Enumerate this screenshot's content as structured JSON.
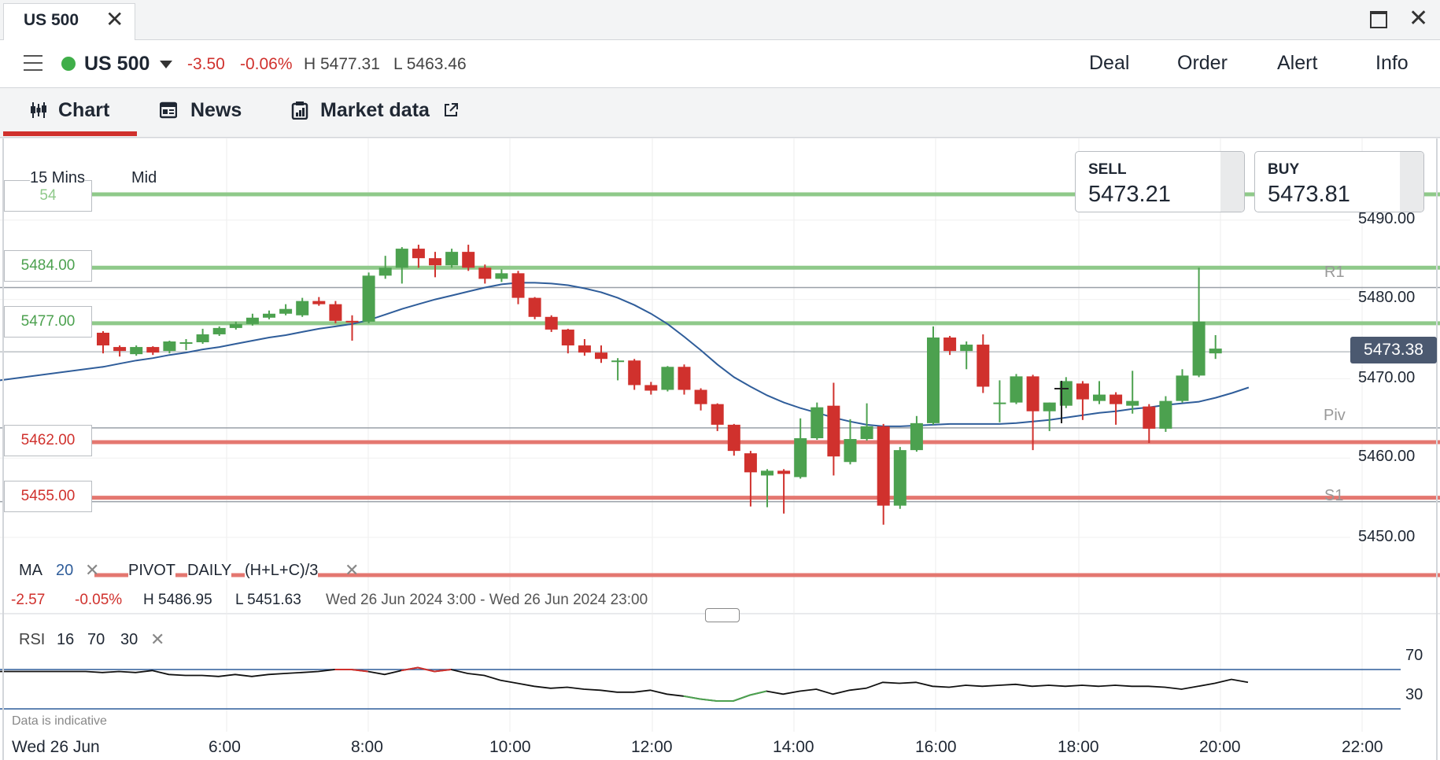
{
  "window": {
    "tab_title": "US 500",
    "tab_close": "✕",
    "maximize_icon": "window-maximize-icon",
    "close_icon": "✕"
  },
  "instrument": {
    "name": "US 500",
    "status_color": "#3fae49",
    "change": "-3.50",
    "change_pct": "-0.06%",
    "high": "H 5477.31",
    "low": "L 5463.46"
  },
  "actions": {
    "deal": "Deal",
    "order": "Order",
    "alert": "Alert",
    "info": "Info"
  },
  "view_tabs": {
    "chart": "Chart",
    "news": "News",
    "market_data": "Market data"
  },
  "chart_controls": {
    "timeframe": "15 Mins",
    "price_type": "Mid"
  },
  "quotes": {
    "sell_label": "SELL",
    "sell_value": "5473.21",
    "buy_label": "BUY",
    "buy_value": "5473.81"
  },
  "level_labels": {
    "top_partial": "54",
    "r_green_1": "5484.00",
    "r_green_2": "5477.00",
    "s_red_1": "5462.00",
    "s_red_2": "5455.00"
  },
  "pivot_labels": {
    "r1": "R1",
    "piv": "Piv",
    "s1": "S1"
  },
  "current_price": "5473.38",
  "indicators": {
    "ma_label": "MA",
    "ma_period": "20",
    "pivot_label": "PIVOT",
    "pivot_period": "DAILY",
    "pivot_formula": "(H+L+C)/3",
    "close": "✕"
  },
  "summary": {
    "change": "-2.57",
    "change_pct": "-0.05%",
    "high": "H 5486.95",
    "low": "L 5451.63",
    "range": "Wed 26 Jun 2024 3:00 - Wed 26 Jun 2024 23:00"
  },
  "rsi": {
    "label": "RSI",
    "period": "16",
    "upper": "70",
    "lower": "30",
    "tick_upper": "70",
    "tick_lower": "30",
    "values": [
      68,
      67,
      68,
      67,
      69,
      65,
      64,
      64,
      63,
      65,
      63,
      65,
      66,
      67,
      68,
      70,
      70,
      68,
      65,
      69,
      72,
      68,
      70,
      66,
      64,
      59,
      56,
      53,
      51,
      52,
      50,
      49,
      47,
      47,
      49,
      45,
      43,
      40,
      38,
      38,
      44,
      48,
      45,
      48,
      50,
      45,
      49,
      51,
      57,
      56,
      57,
      53,
      52,
      54,
      53,
      54,
      55,
      53,
      54,
      53,
      54,
      53,
      54,
      53,
      53,
      52,
      50,
      53,
      56,
      60,
      57
    ]
  },
  "disclaimer": "Data is indicative",
  "x_axis": {
    "date_label": "Wed 26 Jun",
    "ticks": [
      "6:00",
      "8:00",
      "10:00",
      "12:00",
      "14:00",
      "16:00",
      "18:00",
      "20:00",
      "22:00"
    ]
  },
  "colors": {
    "up": "#4ca14f",
    "down": "#d0312d",
    "ma": "#2f5d9a",
    "resistance": "#8fc98a",
    "support": "#e47770",
    "grid": "#9aa0a8"
  },
  "chart_data": {
    "type": "candlestick",
    "timeframe": "15 Mins",
    "y_ticks": [
      "5450.00",
      "5460.00",
      "5470.00",
      "5480.00",
      "5490.00"
    ],
    "ylim": [
      5444,
      5498
    ],
    "horizontal_levels": {
      "R1": 5481.5,
      "Pivot": 5463.8,
      "S1": 5454.5,
      "resistance": [
        5484.0,
        5477.0
      ],
      "support": [
        5462.0,
        5455.0
      ]
    },
    "moving_average": {
      "period": 20,
      "values": [
        5471.5,
        5471.9,
        5472.3,
        5472.6,
        5473.0,
        5473.3,
        5473.7,
        5474.0,
        5474.4,
        5474.8,
        5475.2,
        5475.5,
        5475.9,
        5476.3,
        5476.6,
        5476.9,
        5477.4,
        5478.1,
        5478.8,
        5479.4,
        5480.0,
        5480.5,
        5481.0,
        5481.5,
        5481.9,
        5482.1,
        5482.1,
        5482.0,
        5481.8,
        5481.4,
        5480.9,
        5480.2,
        5479.3,
        5478.2,
        5476.9,
        5475.3,
        5473.6,
        5471.8,
        5470.2,
        5469.0,
        5467.9,
        5467.0,
        5466.3,
        5465.7,
        5465.1,
        5464.6,
        5464.2,
        5464.0,
        5464.0,
        5464.1,
        5464.2,
        5464.3,
        5464.3,
        5464.3,
        5464.3,
        5464.4,
        5464.6,
        5464.8,
        5465.1,
        5465.4,
        5465.7,
        5465.9,
        5466.2,
        5466.4,
        5466.7,
        5466.9,
        5467.1,
        5467.6,
        5468.2,
        5468.9
      ]
    },
    "candles": [
      {
        "o": 5475.8,
        "h": 5476.0,
        "l": 5473.2,
        "c": 5474.2
      },
      {
        "o": 5474.0,
        "h": 5474.2,
        "l": 5472.8,
        "c": 5473.5
      },
      {
        "o": 5473.1,
        "h": 5474.2,
        "l": 5472.9,
        "c": 5474.0
      },
      {
        "o": 5474.0,
        "h": 5474.1,
        "l": 5473.0,
        "c": 5473.3
      },
      {
        "o": 5473.5,
        "h": 5474.8,
        "l": 5473.2,
        "c": 5474.7
      },
      {
        "o": 5474.5,
        "h": 5475.0,
        "l": 5473.6,
        "c": 5474.6
      },
      {
        "o": 5474.6,
        "h": 5476.3,
        "l": 5474.4,
        "c": 5475.6
      },
      {
        "o": 5475.6,
        "h": 5476.6,
        "l": 5475.4,
        "c": 5476.4
      },
      {
        "o": 5476.4,
        "h": 5477.2,
        "l": 5476.2,
        "c": 5476.9
      },
      {
        "o": 5476.9,
        "h": 5478.2,
        "l": 5476.7,
        "c": 5477.7
      },
      {
        "o": 5477.7,
        "h": 5478.6,
        "l": 5477.5,
        "c": 5478.2
      },
      {
        "o": 5478.2,
        "h": 5479.4,
        "l": 5478.0,
        "c": 5478.8
      },
      {
        "o": 5478.0,
        "h": 5480.2,
        "l": 5477.8,
        "c": 5479.8
      },
      {
        "o": 5479.8,
        "h": 5480.3,
        "l": 5479.2,
        "c": 5479.4
      },
      {
        "o": 5479.4,
        "h": 5479.8,
        "l": 5477.0,
        "c": 5477.3
      },
      {
        "o": 5477.3,
        "h": 5478.0,
        "l": 5474.8,
        "c": 5477.2
      },
      {
        "o": 5477.2,
        "h": 5483.4,
        "l": 5477.0,
        "c": 5483.0
      },
      {
        "o": 5483.0,
        "h": 5485.5,
        "l": 5482.6,
        "c": 5484.0
      },
      {
        "o": 5484.0,
        "h": 5486.6,
        "l": 5482.0,
        "c": 5486.4
      },
      {
        "o": 5486.4,
        "h": 5486.9,
        "l": 5484.0,
        "c": 5485.2
      },
      {
        "o": 5485.2,
        "h": 5486.0,
        "l": 5482.8,
        "c": 5484.3
      },
      {
        "o": 5484.3,
        "h": 5486.4,
        "l": 5484.0,
        "c": 5486.0
      },
      {
        "o": 5486.0,
        "h": 5486.9,
        "l": 5483.6,
        "c": 5484.0
      },
      {
        "o": 5484.0,
        "h": 5484.4,
        "l": 5482.0,
        "c": 5482.6
      },
      {
        "o": 5482.6,
        "h": 5483.8,
        "l": 5482.2,
        "c": 5483.3
      },
      {
        "o": 5483.3,
        "h": 5483.6,
        "l": 5479.4,
        "c": 5480.2
      },
      {
        "o": 5480.2,
        "h": 5480.3,
        "l": 5477.5,
        "c": 5477.8
      },
      {
        "o": 5477.8,
        "h": 5478.0,
        "l": 5475.9,
        "c": 5476.2
      },
      {
        "o": 5476.2,
        "h": 5476.3,
        "l": 5473.2,
        "c": 5474.2
      },
      {
        "o": 5474.2,
        "h": 5475.0,
        "l": 5472.9,
        "c": 5473.3
      },
      {
        "o": 5473.3,
        "h": 5474.2,
        "l": 5472.0,
        "c": 5472.5
      },
      {
        "o": 5472.3,
        "h": 5472.6,
        "l": 5469.8,
        "c": 5472.3
      },
      {
        "o": 5472.3,
        "h": 5472.5,
        "l": 5468.6,
        "c": 5469.2
      },
      {
        "o": 5469.2,
        "h": 5469.6,
        "l": 5468.0,
        "c": 5468.5
      },
      {
        "o": 5468.6,
        "h": 5471.6,
        "l": 5468.4,
        "c": 5471.5
      },
      {
        "o": 5471.5,
        "h": 5471.8,
        "l": 5468.0,
        "c": 5468.6
      },
      {
        "o": 5468.6,
        "h": 5468.8,
        "l": 5466.0,
        "c": 5466.8
      },
      {
        "o": 5466.8,
        "h": 5466.9,
        "l": 5463.4,
        "c": 5464.2
      },
      {
        "o": 5464.2,
        "h": 5464.3,
        "l": 5460.3,
        "c": 5460.9
      },
      {
        "o": 5460.6,
        "h": 5460.9,
        "l": 5453.9,
        "c": 5458.2
      },
      {
        "o": 5457.8,
        "h": 5458.6,
        "l": 5453.8,
        "c": 5458.4
      },
      {
        "o": 5458.4,
        "h": 5458.6,
        "l": 5453.0,
        "c": 5458.0
      },
      {
        "o": 5457.6,
        "h": 5465.0,
        "l": 5457.4,
        "c": 5462.5
      },
      {
        "o": 5462.5,
        "h": 5467.0,
        "l": 5462.3,
        "c": 5466.4
      },
      {
        "o": 5466.6,
        "h": 5469.5,
        "l": 5457.8,
        "c": 5460.2
      },
      {
        "o": 5459.5,
        "h": 5464.9,
        "l": 5459.2,
        "c": 5462.4
      },
      {
        "o": 5462.4,
        "h": 5466.9,
        "l": 5462.2,
        "c": 5464.0
      },
      {
        "o": 5464.0,
        "h": 5464.3,
        "l": 5451.6,
        "c": 5454.0
      },
      {
        "o": 5454.0,
        "h": 5461.4,
        "l": 5453.6,
        "c": 5461.0
      },
      {
        "o": 5461.0,
        "h": 5465.3,
        "l": 5460.8,
        "c": 5464.4
      },
      {
        "o": 5464.4,
        "h": 5476.6,
        "l": 5464.2,
        "c": 5475.2
      },
      {
        "o": 5475.2,
        "h": 5475.4,
        "l": 5473.0,
        "c": 5473.5
      },
      {
        "o": 5473.5,
        "h": 5474.7,
        "l": 5471.2,
        "c": 5474.3
      },
      {
        "o": 5474.3,
        "h": 5475.6,
        "l": 5468.2,
        "c": 5469.0
      },
      {
        "o": 5467.0,
        "h": 5469.8,
        "l": 5464.5,
        "c": 5467.0
      },
      {
        "o": 5467.0,
        "h": 5470.6,
        "l": 5466.8,
        "c": 5470.3
      },
      {
        "o": 5470.3,
        "h": 5470.5,
        "l": 5461.0,
        "c": 5465.9
      },
      {
        "o": 5465.9,
        "h": 5467.0,
        "l": 5463.4,
        "c": 5467.0
      },
      {
        "o": 5466.6,
        "h": 5470.2,
        "l": 5466.3,
        "c": 5469.7
      },
      {
        "o": 5469.4,
        "h": 5469.7,
        "l": 5464.8,
        "c": 5467.4
      },
      {
        "o": 5467.2,
        "h": 5469.7,
        "l": 5466.8,
        "c": 5468.0
      },
      {
        "o": 5468.0,
        "h": 5468.3,
        "l": 5464.2,
        "c": 5466.8
      },
      {
        "o": 5466.6,
        "h": 5471.0,
        "l": 5465.6,
        "c": 5467.2
      },
      {
        "o": 5466.5,
        "h": 5466.8,
        "l": 5461.9,
        "c": 5463.7
      },
      {
        "o": 5463.7,
        "h": 5467.8,
        "l": 5463.3,
        "c": 5467.2
      },
      {
        "o": 5467.2,
        "h": 5471.2,
        "l": 5467.0,
        "c": 5470.4
      },
      {
        "o": 5470.4,
        "h": 5484.0,
        "l": 5470.2,
        "c": 5477.2
      },
      {
        "o": 5473.2,
        "h": 5475.5,
        "l": 5472.5,
        "c": 5473.8
      }
    ]
  }
}
